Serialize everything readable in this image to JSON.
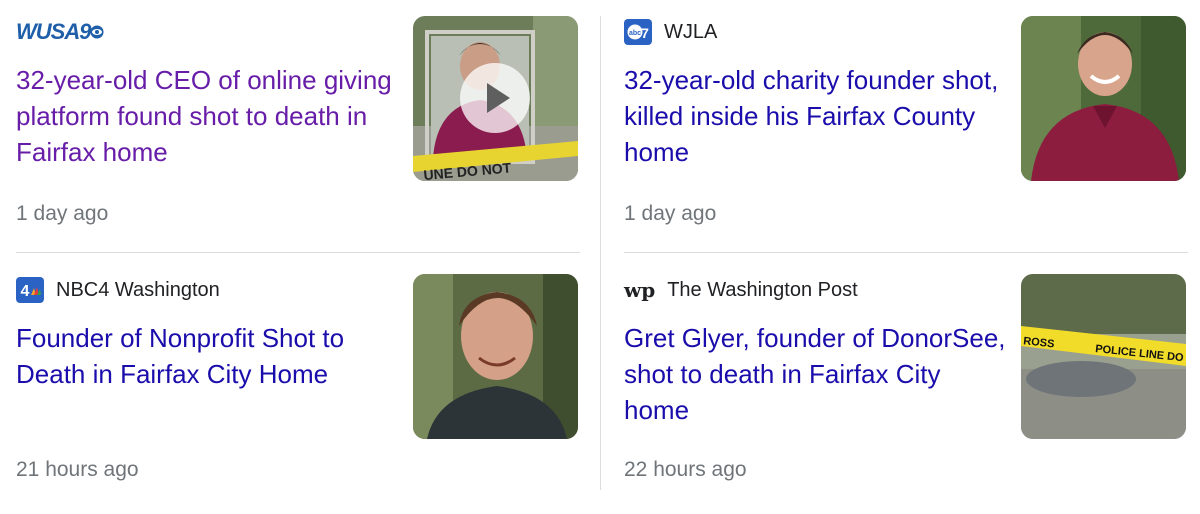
{
  "articles": [
    {
      "source": "WUSA9",
      "logo_text": "WUSA9",
      "logo_icon": "wusa9-cbs-eye-logo",
      "headline": "32-year-old CEO of online giving platform found shot to death in Fairfax home",
      "time": "1 day ago",
      "visited": true,
      "thumbnail": "video-thumbnail-man-crime-tape",
      "has_play_button": true
    },
    {
      "source": "WJLA",
      "logo_icon": "abc7-logo",
      "logo_text": "abc7",
      "headline": "32-year-old charity founder shot, killed inside his Fairfax County home",
      "time": "1 day ago",
      "visited": false,
      "thumbnail": "photo-man-smiling-maroon-shirt"
    },
    {
      "source": "NBC4 Washington",
      "logo_icon": "nbc4-logo",
      "logo_text": "4",
      "headline": "Founder of Nonprofit Shot to Death in Fairfax City Home",
      "time": "21 hours ago",
      "visited": false,
      "thumbnail": "photo-man-smiling-outdoors"
    },
    {
      "source": "The Washington Post",
      "logo_icon": "washington-post-logo",
      "logo_text": "wp",
      "headline": "Gret Glyer, founder of DonorSee, shot to death in Fairfax City home",
      "time": "22 hours ago",
      "visited": false,
      "thumbnail": "photo-police-tape",
      "tape_text": "POLICE LINE DO NOT",
      "tape_text_left": "ROSS"
    }
  ],
  "colors": {
    "link": "#1a0dab",
    "visited": "#681da8",
    "meta": "#70757a",
    "divider": "#dadce0"
  }
}
